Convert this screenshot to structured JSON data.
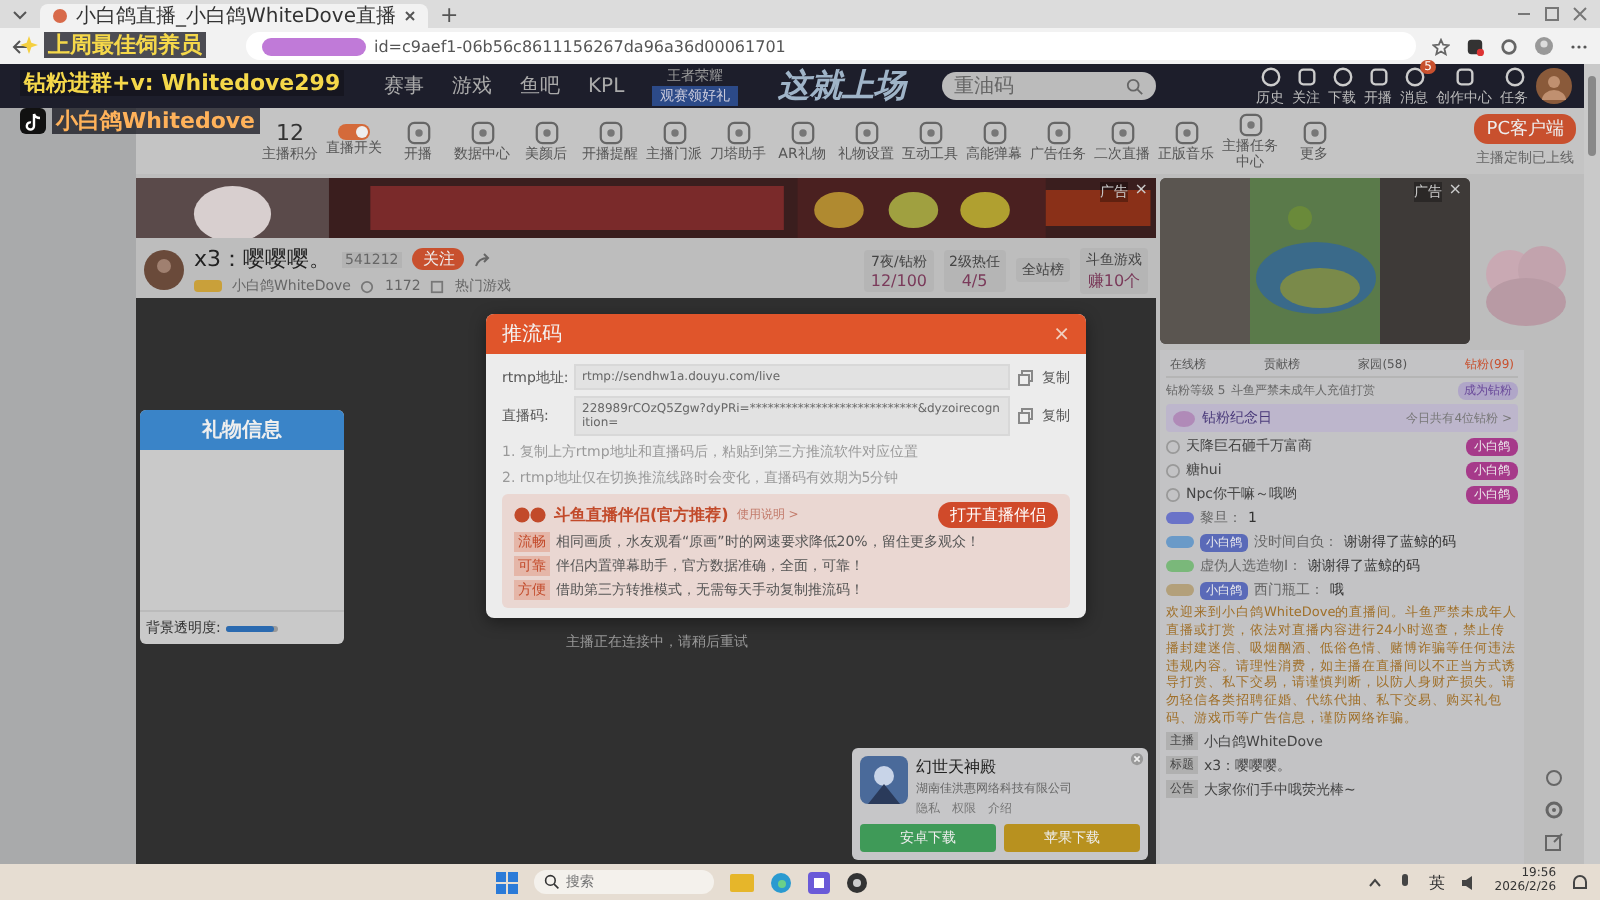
{
  "browser": {
    "tab_title": "小白鸽直播_小白鸽WhiteDove直播",
    "new_tab": "+",
    "url": "id=c9aef1-06b56c8611156267da96a36d00061701"
  },
  "overlay_texts": [
    {
      "text": "上周最佳饲养员",
      "kind": "star"
    },
    {
      "text": "钻粉进群+v: Whitedove299",
      "kind": "plain"
    },
    {
      "text": "小白鸽Whitedove",
      "kind": "tiktok"
    }
  ],
  "nav": {
    "items": [
      "赛事",
      "游戏",
      "鱼吧",
      "KPL"
    ],
    "promo": {
      "title": "王者荣耀",
      "sub": "观赛领好礼"
    },
    "logo": "这就上场",
    "search": {
      "placeholder": "重油码"
    },
    "actions": [
      {
        "label": "历史"
      },
      {
        "label": "关注"
      },
      {
        "label": "下载"
      },
      {
        "label": "开播"
      },
      {
        "label": "消息",
        "badge": "5"
      },
      {
        "label": "创作中心"
      },
      {
        "label": "任务"
      }
    ]
  },
  "toolbar": {
    "score": {
      "value": "12",
      "label": "主播积分"
    },
    "toggle": {
      "label": "直播开关",
      "on": true
    },
    "tools": [
      "开播",
      "数据中心",
      "美颜后",
      "开播提醒",
      "主播门派",
      "刀塔助手",
      "AR礼物",
      "礼物设置",
      "互动工具",
      "高能弹幕",
      "广告任务",
      "二次直播",
      "正版音乐",
      "主播任务中心",
      "更多"
    ],
    "pc_button": "PC客户端",
    "pc_note": "主播定制已上线"
  },
  "banner": {
    "ad_label": "广告",
    "close": "×"
  },
  "video_ad": {
    "ad_label": "广告",
    "close": "×"
  },
  "streamer": {
    "name": "x3：嘤嘤嘤。",
    "room": "541212",
    "follow": "关注",
    "nickname": "小白鸽WhiteDove",
    "likes": "1172",
    "category": "热门游戏",
    "stats": [
      {
        "title": "7夜/钻粉",
        "value": "12/100"
      },
      {
        "title": "2级热任",
        "value": "4/5"
      },
      {
        "title": "全站榜"
      },
      {
        "title": "斗鱼游戏",
        "value": "赚10个"
      }
    ]
  },
  "player": {
    "status": "主播正在连接中，请稍后重试",
    "gift_panel": {
      "title": "礼物信息",
      "opacity_label": "背景透明度:",
      "level": 0.9
    }
  },
  "modal": {
    "title": "推流码",
    "close": "×",
    "fields": [
      {
        "label": "rtmp地址:",
        "value": "rtmp://sendhw1a.douyu.com/live",
        "action": "复制"
      },
      {
        "label": "直播码:",
        "value": "228989rCOzQ5Zgw?dyPRi=****************************&dyzoirecognition=",
        "action": "复制"
      }
    ],
    "notes": [
      "1. 复制上方rtmp地址和直播码后，粘贴到第三方推流软件对应位置",
      "2. rtmp地址仅在切换推流线路时会变化，直播码有效期为5分钟"
    ],
    "promo": {
      "title": "斗鱼直播伴侣(官方推荐)",
      "link": "使用说明 >",
      "button": "打开直播伴侣",
      "points": [
        {
          "tag": "流畅",
          "text": "相同画质，水友观看“原画”时的网速要求降低20%，留住更多观众！"
        },
        {
          "tag": "可靠",
          "text": "伴侣内置弹幕助手，官方数据准确，全面，可靠！"
        },
        {
          "tag": "方便",
          "text": "借助第三方转推模式，无需每天手动复制推流码！"
        }
      ]
    }
  },
  "chat": {
    "tabs": [
      {
        "label": "在线榜",
        "selected": false
      },
      {
        "label": "贡献榜",
        "selected": false
      },
      {
        "label": "家园(58)",
        "selected": false
      },
      {
        "label": "钻粉(99)",
        "selected": true
      }
    ],
    "fan_bar": {
      "level_text": "钻粉等级 5",
      "notice": "斗鱼严禁未成年人充值打赏",
      "button": "成为钻粉"
    },
    "anniversary": {
      "title": "钻粉纪念日",
      "link": "今日共有4位钻粉 >"
    },
    "fans": [
      {
        "name": "天降巨石砸千万富商",
        "badge": "小白鸽"
      },
      {
        "name": "糖hui",
        "badge": "小白鸽"
      },
      {
        "name": "Npc你干嘛～哦哟",
        "badge": "小白鸽"
      }
    ],
    "messages": [
      {
        "user": "黎旦：",
        "text": "1",
        "color": "#6a73c8"
      },
      {
        "user": "没时间自负：",
        "text": "谢谢得了蓝鲸的码",
        "color": "#6a9ac8",
        "fan_badge": "小白鸽"
      },
      {
        "user": "虚伪人选造物I：",
        "text": "谢谢得了蓝鲸的码",
        "color": "#7ab87a"
      },
      {
        "user": "西门瓶工：",
        "text": "哦",
        "color": "#b3a07a",
        "fan_badge": "小白鸽"
      }
    ],
    "notice": "欢迎来到小白鸽WhiteDove的直播间。斗鱼严禁未成年人直播或打赏，依法对直播内容进行24小时巡查，禁止传播封建迷信、吸烟酗酒、低俗色情、赌博诈骗等任何违法违规内容。请理性消费，如主播在直播间以不正当方式诱导打赏、私下交易，请谨慎判断，以防人身财产损失。请勿轻信各类招聘征婚、代练代抽、私下交易、购买礼包码、游戏币等广告信息，谨防网络诈骗。",
    "info": [
      {
        "tag": "主播",
        "text": "小白鸽WhiteDove"
      },
      {
        "tag": "标题",
        "text": "x3：嘤嘤嘤。"
      },
      {
        "tag": "公告",
        "text": "大家你们手中哦荧光棒~"
      }
    ]
  },
  "ad_card": {
    "title": "幻世天神殿",
    "company": "湖南佳洪惠网络科技有限公司",
    "links": [
      "隐私",
      "权限",
      "介绍"
    ],
    "buttons": [
      {
        "label": "安卓下载",
        "kind": "android"
      },
      {
        "label": "苹果下载",
        "kind": "ios"
      }
    ]
  },
  "taskbar": {
    "search": {
      "placeholder": "搜索"
    },
    "ime": "英",
    "time": "19:56",
    "date": "2026/2/26"
  }
}
